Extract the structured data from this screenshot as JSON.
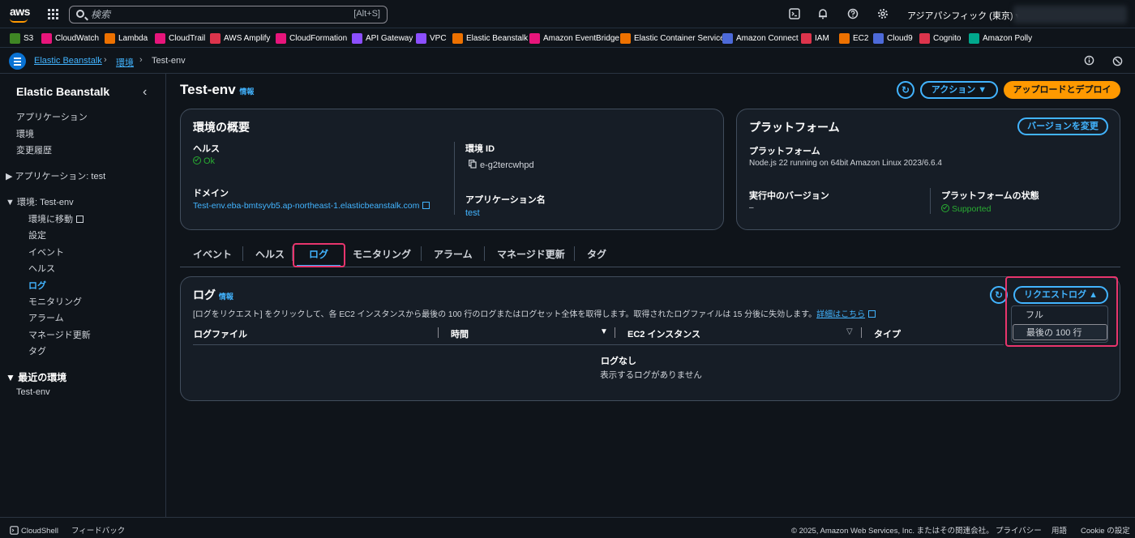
{
  "topnav": {
    "logo": "aws",
    "search_placeholder": "検索",
    "search_shortcut": "[Alt+S]",
    "region": "アジアパシフィック (東京) ▾",
    "icons": [
      "cloudshell-icon",
      "bell-icon",
      "help-icon",
      "gear-icon"
    ]
  },
  "favorites": [
    {
      "label": "S3",
      "color": "#3f8624"
    },
    {
      "label": "CloudWatch",
      "color": "#e7157b"
    },
    {
      "label": "Lambda",
      "color": "#ed7100"
    },
    {
      "label": "CloudTrail",
      "color": "#e7157b"
    },
    {
      "label": "AWS Amplify",
      "color": "#dd344c"
    },
    {
      "label": "CloudFormation",
      "color": "#e7157b"
    },
    {
      "label": "API Gateway",
      "color": "#8c4fff"
    },
    {
      "label": "VPC",
      "color": "#8c4fff"
    },
    {
      "label": "Elastic Beanstalk",
      "color": "#ed7100"
    },
    {
      "label": "Amazon EventBridge",
      "color": "#e7157b"
    },
    {
      "label": "Elastic Container Service",
      "color": "#ed7100"
    },
    {
      "label": "Amazon Connect",
      "color": "#4d6ad9"
    },
    {
      "label": "IAM",
      "color": "#dd344c"
    },
    {
      "label": "EC2",
      "color": "#ed7100"
    },
    {
      "label": "Cloud9",
      "color": "#4d6ad9"
    },
    {
      "label": "Cognito",
      "color": "#dd344c"
    },
    {
      "label": "Amazon Polly",
      "color": "#01a88d"
    }
  ],
  "breadcrumb": {
    "items": [
      "Elastic Beanstalk",
      "環境",
      "Test-env"
    ]
  },
  "sidebar": {
    "title": "Elastic Beanstalk",
    "items": [
      "アプリケーション",
      "環境",
      "変更履歴"
    ],
    "app_group": "アプリケーション: test",
    "env_group": "環境: Test-env",
    "env_items": [
      "環境に移動",
      "設定",
      "イベント",
      "ヘルス",
      "ログ",
      "モニタリング",
      "アラーム",
      "マネージド更新",
      "タグ"
    ],
    "recent_group": "最近の環境",
    "recent_items": [
      "Test-env"
    ]
  },
  "page": {
    "title": "Test-env",
    "info": "情報",
    "actions_button": "アクション ▼",
    "deploy_button": "アップロードとデプロイ"
  },
  "overview": {
    "title": "環境の概要",
    "health_label": "ヘルス",
    "health_value": "Ok",
    "domain_label": "ドメイン",
    "domain_value": "Test-env.eba-bmtsyvb5.ap-northeast-1.elasticbeanstalk.com",
    "env_id_label": "環境 ID",
    "env_id_value": "e-g2tercwhpd",
    "app_name_label": "アプリケーション名",
    "app_name_value": "test"
  },
  "platform": {
    "title": "プラットフォーム",
    "change_button": "バージョンを変更",
    "platform_label": "プラットフォーム",
    "platform_value": "Node.js 22 running on 64bit Amazon Linux 2023/6.6.4",
    "running_version_label": "実行中のバージョン",
    "running_version_value": "–",
    "state_label": "プラットフォームの状態",
    "state_value": "Supported"
  },
  "tabs": [
    "イベント",
    "ヘルス",
    "ログ",
    "モニタリング",
    "アラーム",
    "マネージド更新",
    "タグ"
  ],
  "logs": {
    "title": "ログ",
    "info": "情報",
    "description": "[ログをリクエスト] をクリックして、各 EC2 インスタンスから最後の 100 行のログまたはログセット全体を取得します。取得されたログファイルは 15 分後に失効します。",
    "details_link": "詳細はこちら",
    "request_button": "リクエストログ ▲",
    "dropdown_items": [
      "フル",
      "最後の 100 行"
    ],
    "columns": [
      "ログファイル",
      "時間",
      "EC2 インスタンス",
      "タイプ"
    ],
    "empty_title": "ログなし",
    "empty_text": "表示するログがありません"
  },
  "footer": {
    "cloudshell": "CloudShell",
    "feedback": "フィードバック",
    "copyright": "© 2025, Amazon Web Services, Inc. またはその関連会社。",
    "privacy": "プライバシー",
    "terms": "用語",
    "cookies": "Cookie の設定"
  }
}
